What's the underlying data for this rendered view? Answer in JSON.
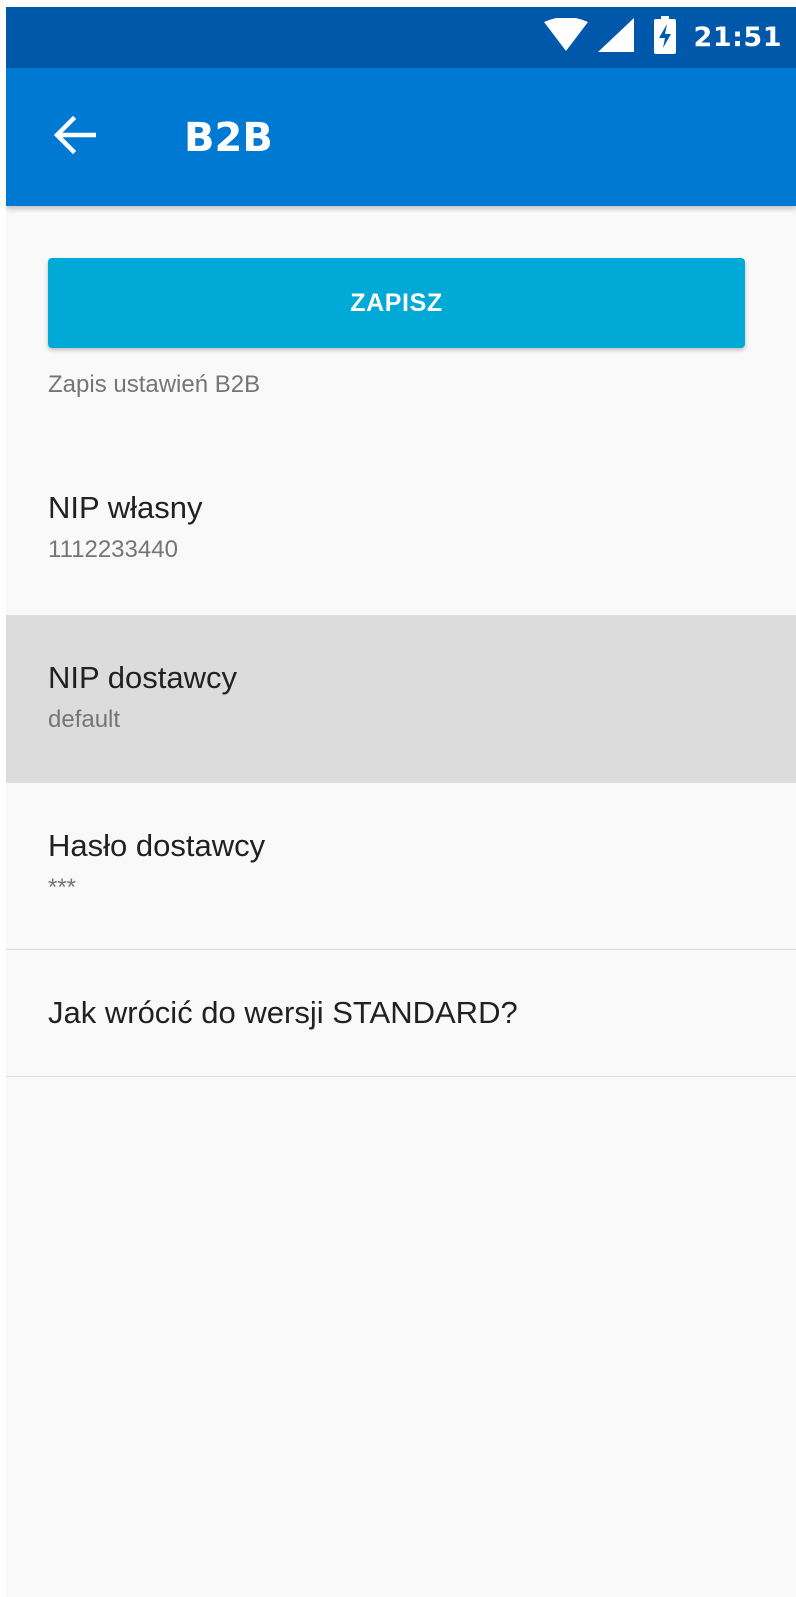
{
  "status_bar": {
    "time": "21:51",
    "icons": [
      "wifi-icon",
      "signal-icon",
      "battery-charging-icon"
    ]
  },
  "app_bar": {
    "title": "B2B",
    "back_icon": "arrow-left-icon"
  },
  "save": {
    "button_label": "ZAPISZ",
    "hint": "Zapis ustawień B2B"
  },
  "preferences": [
    {
      "title": "NIP własny",
      "summary": "1112233440"
    },
    {
      "title": "NIP dostawcy",
      "summary": "default"
    },
    {
      "title": "Hasło dostawcy",
      "summary": "***"
    },
    {
      "title": "Jak wrócić do wersji STANDARD?"
    }
  ],
  "colors": {
    "status_bar": "#0058aa",
    "app_bar": "#0079d3",
    "save_button": "#00a9d6",
    "highlight_row": "#dcdcdc",
    "background": "#f9f9f9"
  }
}
